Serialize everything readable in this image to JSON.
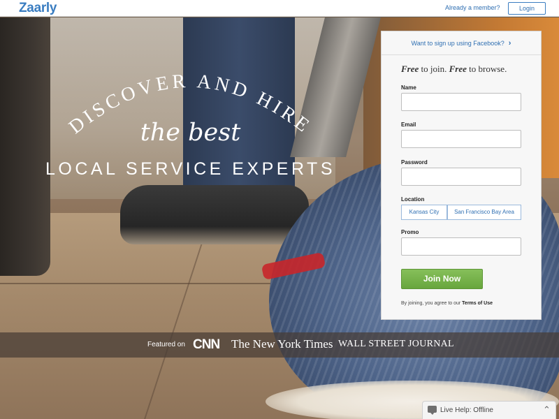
{
  "header": {
    "logo": "Zaarly",
    "member_text": "Already a member?",
    "login_label": "Login"
  },
  "hero": {
    "arc_line": "DISCOVER AND HIRE",
    "emphasis": "the best",
    "subline": "LOCAL SERVICE EXPERTS"
  },
  "featured": {
    "label": "Featured on",
    "outlets": [
      "CNN",
      "The New York Times",
      "WALL STREET JOURNAL"
    ]
  },
  "signup": {
    "facebook_link": "Want to sign up using Facebook?",
    "tagline_free1": "Free",
    "tagline_join": " to join. ",
    "tagline_free2": "Free",
    "tagline_browse": " to browse.",
    "fields": {
      "name": {
        "label": "Name",
        "value": ""
      },
      "email": {
        "label": "Email",
        "value": ""
      },
      "password": {
        "label": "Password",
        "value": ""
      },
      "location": {
        "label": "Location",
        "options": [
          "Kansas City",
          "San Francisco Bay Area"
        ]
      },
      "promo": {
        "label": "Promo",
        "value": ""
      }
    },
    "join_label": "Join Now",
    "terms_prefix": "By joining, you agree to our ",
    "terms_link": "Terms of Use"
  },
  "live_help": {
    "text": "Live Help: Offline"
  },
  "colors": {
    "brand_blue": "#3a7dc1",
    "join_green": "#72ad46"
  }
}
